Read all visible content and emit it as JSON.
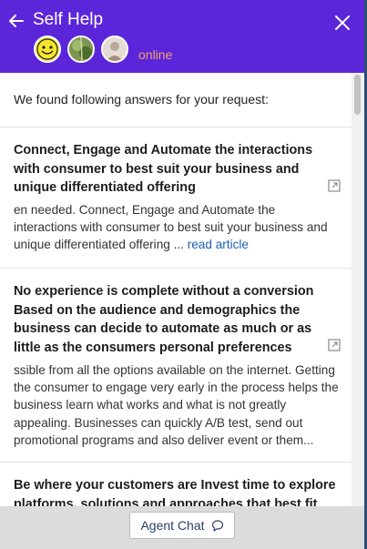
{
  "header": {
    "title": "Self Help",
    "status": "online"
  },
  "content": {
    "intro": "We found following answers for your request:",
    "articles": [
      {
        "title": "Connect, Engage and Automate the interactions with consumer to best suit your business and unique differentiated offering",
        "snippet": "en needed. Connect, Engage and Automate the interactions with consumer to best suit your business and unique differentiated offering",
        "ellipsis": " ... ",
        "link": "read article"
      },
      {
        "title": "No experience is complete without a conversion Based on the audience and demographics the business can decide to automate as much or as little as the consumers personal preferences",
        "snippet": "ssible from all the options available on the internet. Getting the consumer to engage very early in the process helps the business learn what works and what is not greatly appealing. Businesses can quickly A/B test, send out promotional programs and also deliver event or them..."
      },
      {
        "title": "Be where your customers are Invest time to explore platforms, solutions and approaches that best fit your"
      }
    ]
  },
  "footer": {
    "agent_chat_label": "Agent Chat"
  },
  "colors": {
    "header_bg": "#5b26d9",
    "status": "#f2a26c",
    "link": "#1e5fb4"
  },
  "icons": [
    "back-arrow-icon",
    "close-icon",
    "external-link-icon",
    "chat-bubble-icon"
  ]
}
